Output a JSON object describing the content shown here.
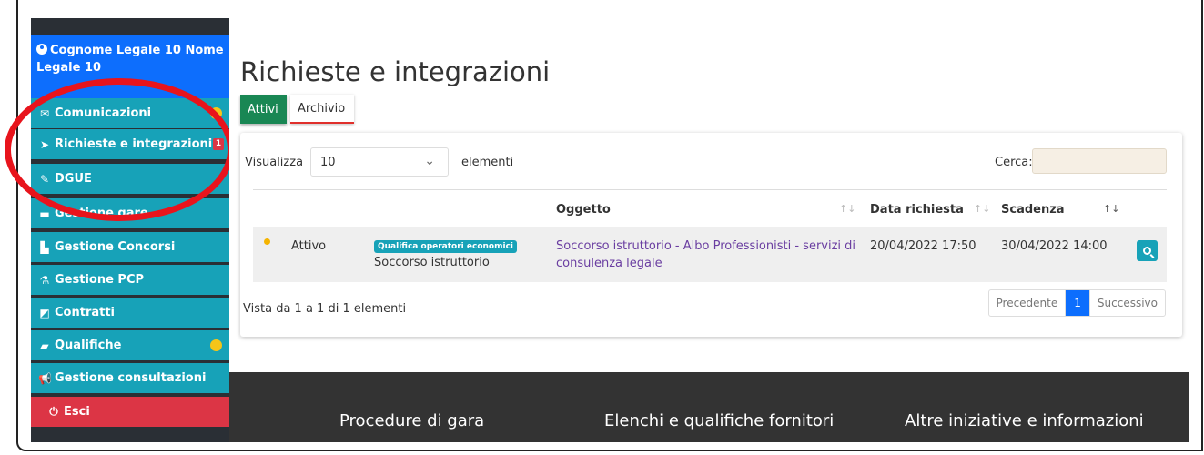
{
  "sidebar": {
    "user": "Cognome Legale 10 Nome Legale 10",
    "items": [
      {
        "label": "Comunicazioni",
        "icon": "envelope-icon",
        "indicator": "dot"
      },
      {
        "label": "Richieste e integrazioni",
        "icon": "paper-plane-icon",
        "indicator": "badge",
        "badge": "1"
      },
      {
        "label": "DGUE",
        "icon": "edit-icon"
      },
      {
        "label": "Gestione gare",
        "icon": "briefcase-icon"
      },
      {
        "label": "Gestione Concorsi",
        "icon": "chart-icon"
      },
      {
        "label": "Gestione PCP",
        "icon": "flask-icon"
      },
      {
        "label": "Contratti",
        "icon": "pencil-square-icon"
      },
      {
        "label": "Qualifiche",
        "icon": "folder-open-icon",
        "indicator": "dot"
      },
      {
        "label": "Gestione consultazioni",
        "icon": "bullhorn-icon"
      }
    ],
    "exit": "Esci"
  },
  "main": {
    "title": "Richieste e integrazioni",
    "tabs": {
      "active": "Attivi",
      "archive": "Archivio"
    },
    "table": {
      "show_label": "Visualizza",
      "page_size": "10",
      "elements_label": "elementi",
      "search_label": "Cerca:",
      "headers": {
        "subject": "Oggetto",
        "request_date": "Data richiesta",
        "deadline": "Scadenza"
      },
      "row": {
        "status": "Attivo",
        "tag": "Qualifica operatori economici",
        "type": "Soccorso istruttorio",
        "subject_line1": "Soccorso istruttorio - Albo Professionisti - servizi di",
        "subject_line2": "consulenza legale",
        "request_date": "20/04/2022 17:50",
        "deadline": "30/04/2022 14:00"
      },
      "info": "Vista da 1 a 1 di 1 elementi",
      "pager": {
        "prev": "Precedente",
        "current": "1",
        "next": "Successivo"
      }
    }
  },
  "footer": {
    "col1": "Procedure di gara",
    "col2": "Elenchi e qualifiche fornitori",
    "col3": "Altre iniziative e informazioni"
  },
  "colors": {
    "sidebar_item": "#17a2b8",
    "user_box": "#0d6efd",
    "exit": "#dc3545",
    "active_tab": "#198754",
    "annotation": "#e8141c"
  }
}
